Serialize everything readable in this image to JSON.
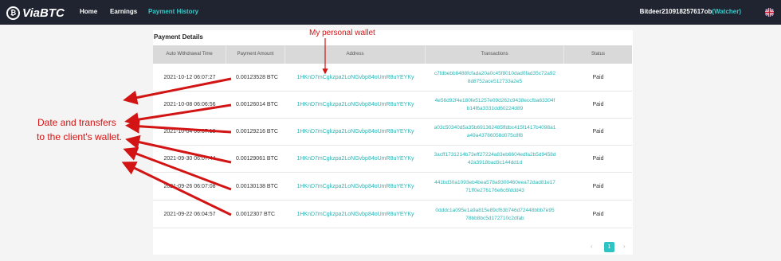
{
  "header": {
    "logo_text": "ViaBTC",
    "nav": [
      "Home",
      "Earnings",
      "Payment History"
    ],
    "active_index": 2,
    "username": "Bitdeer210918257617ob",
    "watcher_label": "(Watcher)",
    "flag_icon": "uk-flag-icon"
  },
  "payment_details": {
    "title": "Payment Details",
    "columns": [
      "Auto Withdrawal Time",
      "Payment Amount",
      "Address",
      "Transactions",
      "Status"
    ],
    "rows": [
      {
        "time": "2021-10-12 06:07:27",
        "amount": "0.00123528 BTC",
        "address": "1HKnD7mCgkzpa2LoNGvbp84oUmR8uYEYKy",
        "tx1": "c7fdbebb8488fcfada20a0c45f8010dad0fad35c72a92",
        "tx2": "8d8752ace512733a2e5",
        "status": "Paid"
      },
      {
        "time": "2021-10-08 06:06:56",
        "amount": "0.00126014 BTC",
        "address": "1HKnD7mCgkzpa2LoNGvbp84oUmR8uYEYKy",
        "tx1": "4e56d92f4e180fe51257e09d262c9438eccfba63304f",
        "tx2": "b14f6a3331dd60224d89",
        "status": "Paid"
      },
      {
        "time": "2021-10-04 06:07:19",
        "amount": "0.00129216 BTC",
        "address": "1HKnD7mCgkzpa2LoNGvbp84oUmR8uYEYKy",
        "tx1": "a03c50340d5a35b691362485ffdbc415f1417b4098a1",
        "tx2": "a49a43786058d075c8f8",
        "status": "Paid"
      },
      {
        "time": "2021-09-30 06:07:44",
        "amount": "0.00129061 BTC",
        "address": "1HKnD7mCgkzpa2LoNGvbp84oUmR8uYEYKy",
        "tx1": "3acff1731214b73eff27224a83eb6604edfa2b5d9458d",
        "tx2": "42a3918bad3c144dd1d",
        "status": "Paid"
      },
      {
        "time": "2021-09-26 06:07:08",
        "amount": "0.00130138 BTC",
        "address": "1HKnD7mCgkzpa2LoNGvbp84oUmR8uYEYKy",
        "tx1": "441bd30a1093eb4bea578a9300460eea72dad81e17",
        "tx2": "71ff0e276176e6c6fddd43",
        "status": "Paid"
      },
      {
        "time": "2021-09-22 06:04:57",
        "amount": "0.0012307 BTC",
        "address": "1HKnD7mCgkzpa2LoNGvbp84oUmR8uYEYKy",
        "tx1": "0dddc1a095e1a9a815e89cf63b746d72448bbb7e95",
        "tx2": "78bb8bc5d172710c2dfab",
        "status": "Paid"
      }
    ],
    "pagination": {
      "prev": "‹",
      "current": "1",
      "next": "›"
    }
  },
  "annotations": {
    "wallet_label": "My personal wallet",
    "side_label_line1": "Date and transfers",
    "side_label_line2": "to the client's wallet.",
    "color": "#d21414"
  }
}
